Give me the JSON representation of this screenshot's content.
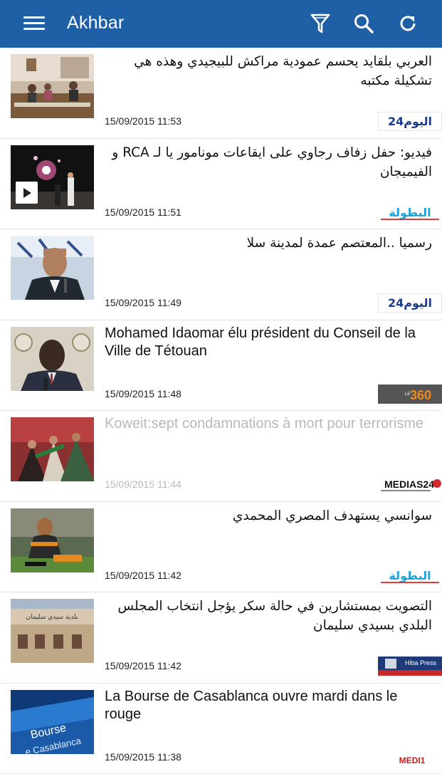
{
  "app": {
    "title": "Akhbar",
    "icons": [
      "menu-icon",
      "filter-icon",
      "search-icon",
      "refresh-icon"
    ],
    "colors": {
      "appbar": "#1e5fa6",
      "read_text": "#b9b9b9"
    }
  },
  "feed": [
    {
      "headline": "العربي بلقايد يحسم عمودية مراكش للبيجيدي وهذه هي تشكيلة مكتبه",
      "rtl": true,
      "time": "15/09/2015 11:53",
      "source": "alyaoum24",
      "logo_text": "اليوم24",
      "read": false,
      "video": false
    },
    {
      "headline": "فيديو: حفل زفاف رجاوي على ايقاعات مونامور يا لـ RCA و الفيميجان",
      "rtl": true,
      "time": "15/09/2015 11:51",
      "source": "elbotola",
      "logo_text": "البطولة",
      "read": false,
      "video": true
    },
    {
      "headline": "رسميا ..المعتصم عمدة لمدينة سلا",
      "rtl": true,
      "time": "15/09/2015 11:49",
      "source": "alyaoum24",
      "logo_text": "اليوم24",
      "read": false,
      "video": false
    },
    {
      "headline": "Mohamed Idaomar élu président du Conseil de la Ville de Tétouan",
      "rtl": false,
      "time": "15/09/2015 11:48",
      "source": "le360",
      "logo_text": "360",
      "read": false,
      "video": false
    },
    {
      "headline": "Koweit:sept condamnations à mort pour terrorisme",
      "rtl": false,
      "time": "15/09/2015 11:44",
      "source": "medias24",
      "logo_text": "MEDIAS24",
      "read": true,
      "video": false
    },
    {
      "headline": "سوانسي يستهدف المصري المحمدي",
      "rtl": true,
      "time": "15/09/2015 11:42",
      "source": "elbotola",
      "logo_text": "البطولة",
      "read": false,
      "video": false
    },
    {
      "headline": "التصويت بمستشارين في حالة سكر يؤجل انتخاب المجلس البلدي بسيدي سليمان",
      "rtl": true,
      "time": "15/09/2015 11:42",
      "source": "hibapress",
      "logo_text": "Hiba Press",
      "read": false,
      "video": false
    },
    {
      "headline": "La Bourse de Casablanca ouvre mardi dans le rouge",
      "rtl": false,
      "time": "15/09/2015 11:38",
      "source": "medi1",
      "logo_text": "MEDI1",
      "read": false,
      "video": false
    }
  ]
}
